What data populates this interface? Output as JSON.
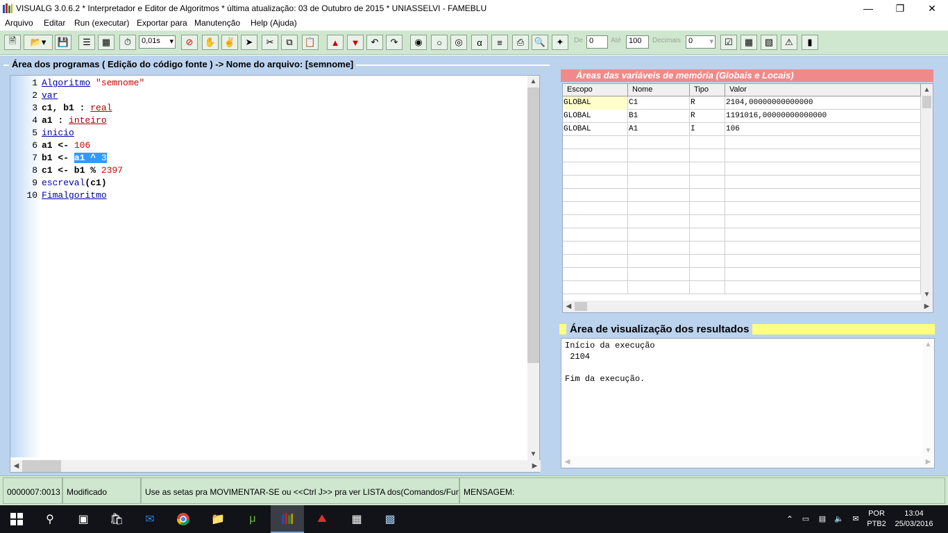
{
  "window": {
    "title": "VISUALG 3.0.6.2 * Interpretador e Editor de Algoritmos * última atualização: 03 de Outubro de 2015 * UNIASSELVI - FAMEBLU",
    "icons": {
      "minimize": "minimize-icon",
      "maximize": "restore-icon",
      "close": "close-icon"
    }
  },
  "menu": [
    "Arquivo",
    "Editar",
    "Run (executar)",
    "Exportar para",
    "Manutenção",
    "Help (Ajuda)"
  ],
  "toolbar": {
    "speed_value": "0,01s",
    "de_label": "De",
    "de_value": "0",
    "ate_label": "Até",
    "ate_value": "100",
    "decimais_label": "Decimais",
    "decimais_value": "0"
  },
  "editor": {
    "header": "Área dos programas ( Edição do código fonte ) -> Nome do arquivo: [semnome]",
    "line_numbers": [
      "1",
      "2",
      "3",
      "4",
      "5",
      "6",
      "7",
      "8",
      "9",
      "10"
    ]
  },
  "variables": {
    "header": "Áreas das variáveis de memória (Globais e Locais)",
    "columns": [
      "Escopo",
      "Nome",
      "Tipo",
      "Valor"
    ],
    "rows": [
      [
        "GLOBAL",
        "C1",
        "R",
        "2104,00000000000000"
      ],
      [
        "GLOBAL",
        "B1",
        "R",
        "1191016,00000000000000"
      ],
      [
        "GLOBAL",
        "A1",
        "I",
        "106"
      ]
    ]
  },
  "results": {
    "header": "Área de visualização dos resultados",
    "lines": [
      "Início da execução",
      " 2104",
      "",
      "Fim da execução."
    ]
  },
  "status": {
    "position": "0000007:0013",
    "state": "Modificado",
    "hint": "Use as setas pra MOVIMENTAR-SE ou <<Ctrl J>> pra ver LISTA dos(Comandos/Funçõ",
    "message": "MENSAGEM:"
  },
  "taskbar": {
    "language": "POR",
    "keyboard": "PTB2",
    "time": "13:04",
    "date": "25/03/2016"
  },
  "colors": {
    "toolbar_bg": "#cfe7cf",
    "main_bg": "#bcd3ee",
    "vars_header": "#f08a8a",
    "results_header": "#ffff80",
    "selection": "#3399ff"
  }
}
